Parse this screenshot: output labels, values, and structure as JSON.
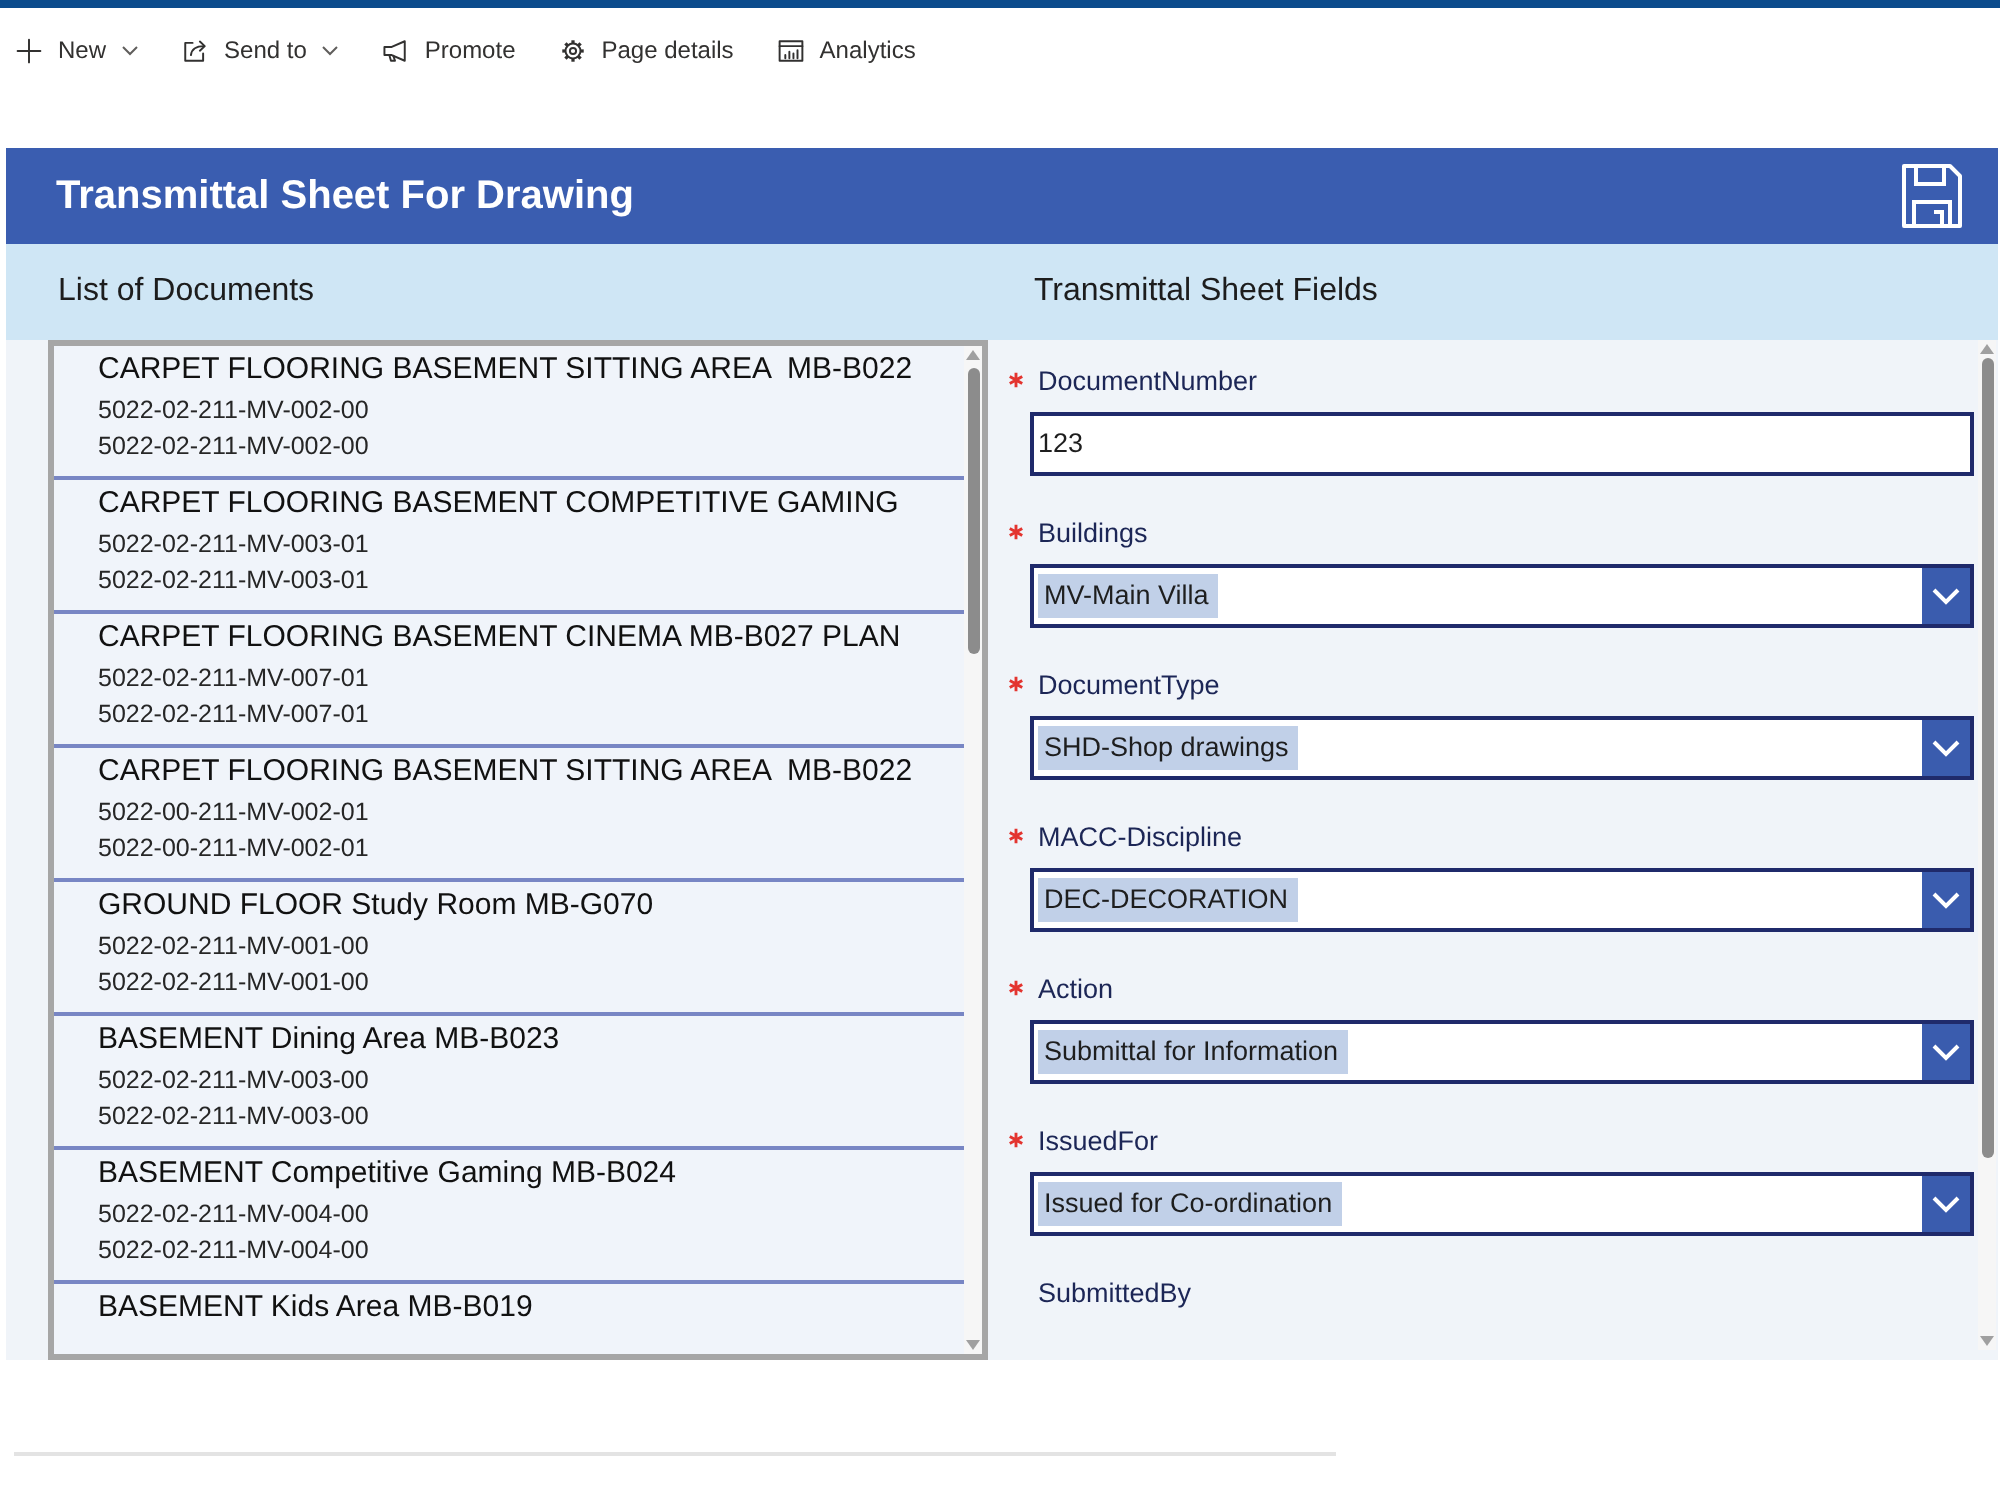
{
  "command_bar": [
    {
      "label": "New",
      "dropdown": true
    },
    {
      "label": "Send to",
      "dropdown": true
    },
    {
      "label": "Promote",
      "dropdown": false
    },
    {
      "label": "Page details",
      "dropdown": false
    },
    {
      "label": "Analytics",
      "dropdown": false
    }
  ],
  "app": {
    "title": "Transmittal Sheet For Drawing"
  },
  "documents": {
    "heading": "List of Documents",
    "items": [
      {
        "title": "CARPET FLOORING BASEMENT SITTING AREA  MB-B022",
        "lines": [
          "5022-02-211-MV-002-00",
          "5022-02-211-MV-002-00"
        ]
      },
      {
        "title": "CARPET FLOORING BASEMENT COMPETITIVE GAMING",
        "lines": [
          "5022-02-211-MV-003-01",
          "5022-02-211-MV-003-01"
        ]
      },
      {
        "title": "CARPET FLOORING BASEMENT CINEMA MB-B027 PLAN",
        "lines": [
          "5022-02-211-MV-007-01",
          "5022-02-211-MV-007-01"
        ]
      },
      {
        "title": "CARPET FLOORING BASEMENT SITTING AREA  MB-B022",
        "lines": [
          "5022-00-211-MV-002-01",
          "5022-00-211-MV-002-01"
        ]
      },
      {
        "title": "GROUND FLOOR Study Room MB-G070",
        "lines": [
          "5022-02-211-MV-001-00",
          "5022-02-211-MV-001-00"
        ]
      },
      {
        "title": "BASEMENT Dining Area MB-B023",
        "lines": [
          "5022-02-211-MV-003-00",
          "5022-02-211-MV-003-00"
        ]
      },
      {
        "title": "BASEMENT Competitive Gaming MB-B024",
        "lines": [
          "5022-02-211-MV-004-00",
          "5022-02-211-MV-004-00"
        ]
      },
      {
        "title": "BASEMENT Kids Area MB-B019"
      }
    ]
  },
  "form": {
    "heading": "Transmittal Sheet Fields",
    "fields": [
      {
        "label": "DocumentNumber",
        "required": true,
        "kind": "text",
        "value": "123"
      },
      {
        "label": "Buildings",
        "required": true,
        "kind": "dropdown",
        "value": "MV-Main Villa"
      },
      {
        "label": "DocumentType",
        "required": true,
        "kind": "dropdown",
        "value": "SHD-Shop drawings"
      },
      {
        "label": "MACC-Discipline",
        "required": true,
        "kind": "dropdown",
        "value": "DEC-DECORATION"
      },
      {
        "label": "Action",
        "required": true,
        "kind": "dropdown",
        "value": "Submittal for Information"
      },
      {
        "label": "IssuedFor",
        "required": true,
        "kind": "dropdown",
        "value": "Issued for Co-ordination"
      },
      {
        "label": "SubmittedBy",
        "required": false,
        "kind": "label"
      }
    ]
  }
}
